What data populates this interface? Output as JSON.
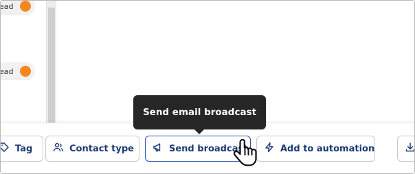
{
  "rows": [
    {
      "status_text": "ead",
      "status_color": "#f7861f"
    },
    {
      "status_text": "ead",
      "status_color": "#f7861f"
    }
  ],
  "toolbar": {
    "tag_label": "Tag",
    "contact_type_label": "Contact type",
    "send_broadcast_label": "Send broadcast",
    "add_to_automation_label": "Add to automation"
  },
  "tooltip": {
    "text": "Send email broadcast"
  },
  "colors": {
    "accent": "#2b53b0",
    "button_text": "#1d3a73",
    "status_dot": "#f7861f",
    "tooltip_bg": "#262626"
  },
  "icons": {
    "tag": "tag-icon",
    "contact_type": "users-icon",
    "send_broadcast": "megaphone-icon",
    "add_to_automation": "lightning-icon",
    "export": "download-icon",
    "cursor": "hand-pointer-icon"
  }
}
